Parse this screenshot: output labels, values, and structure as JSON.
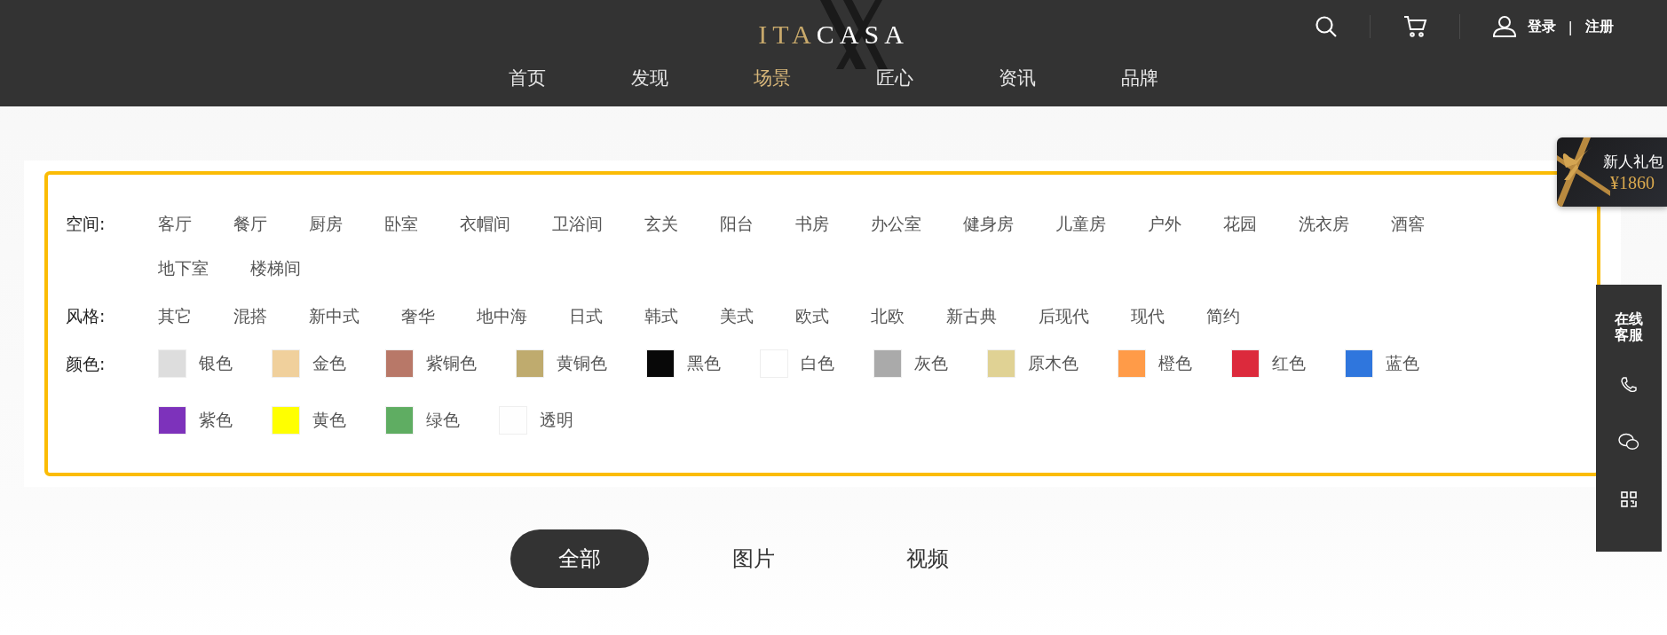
{
  "header": {
    "logo": {
      "accent": "ITA",
      "rest": "CASA"
    },
    "nav": [
      {
        "label": "首页",
        "selected": false
      },
      {
        "label": "发现",
        "selected": false
      },
      {
        "label": "场景",
        "selected": true
      },
      {
        "label": "匠心",
        "selected": false
      },
      {
        "label": "资讯",
        "selected": false
      },
      {
        "label": "品牌",
        "selected": false
      }
    ],
    "login": "登录",
    "separator": "|",
    "register": "注册"
  },
  "filters": [
    {
      "kind": "text",
      "label": "空间:",
      "options": [
        "客厅",
        "餐厅",
        "厨房",
        "卧室",
        "衣帽间",
        "卫浴间",
        "玄关",
        "阳台",
        "书房",
        "办公室",
        "健身房",
        "儿童房",
        "户外",
        "花园",
        "洗衣房",
        "酒窖",
        "地下室",
        "楼梯间"
      ]
    },
    {
      "kind": "text",
      "label": "风格:",
      "options": [
        "其它",
        "混搭",
        "新中式",
        "奢华",
        "地中海",
        "日式",
        "韩式",
        "美式",
        "欧式",
        "北欧",
        "新古典",
        "后现代",
        "现代",
        "简约"
      ]
    },
    {
      "kind": "color",
      "label": "颜色:",
      "options": [
        {
          "label": "银色",
          "color": "#dddddd"
        },
        {
          "label": "金色",
          "color": "#f0d09c"
        },
        {
          "label": "紫铜色",
          "color": "#b87868"
        },
        {
          "label": "黄铜色",
          "color": "#bfab6e"
        },
        {
          "label": "黑色",
          "color": "#080808"
        },
        {
          "label": "白色",
          "color": "#ffffff"
        },
        {
          "label": "灰色",
          "color": "#aaaaaa"
        },
        {
          "label": "原木色",
          "color": "#e0d294"
        },
        {
          "label": "橙色",
          "color": "#ff9b48"
        },
        {
          "label": "红色",
          "color": "#dc2a3c"
        },
        {
          "label": "蓝色",
          "color": "#2f76dd"
        },
        {
          "label": "紫色",
          "color": "#7d32bb"
        },
        {
          "label": "黄色",
          "color": "#ffff00"
        },
        {
          "label": "绿色",
          "color": "#5fad62"
        },
        {
          "label": "透明",
          "color": "#fefefe"
        }
      ]
    }
  ],
  "tabs": [
    {
      "label": "全部",
      "selected": true
    },
    {
      "label": "图片",
      "selected": false
    },
    {
      "label": "视频",
      "selected": false
    }
  ],
  "gift": {
    "title": "新人礼包",
    "amount": "¥1860"
  },
  "side_toolbar": {
    "service": "在线客服"
  }
}
